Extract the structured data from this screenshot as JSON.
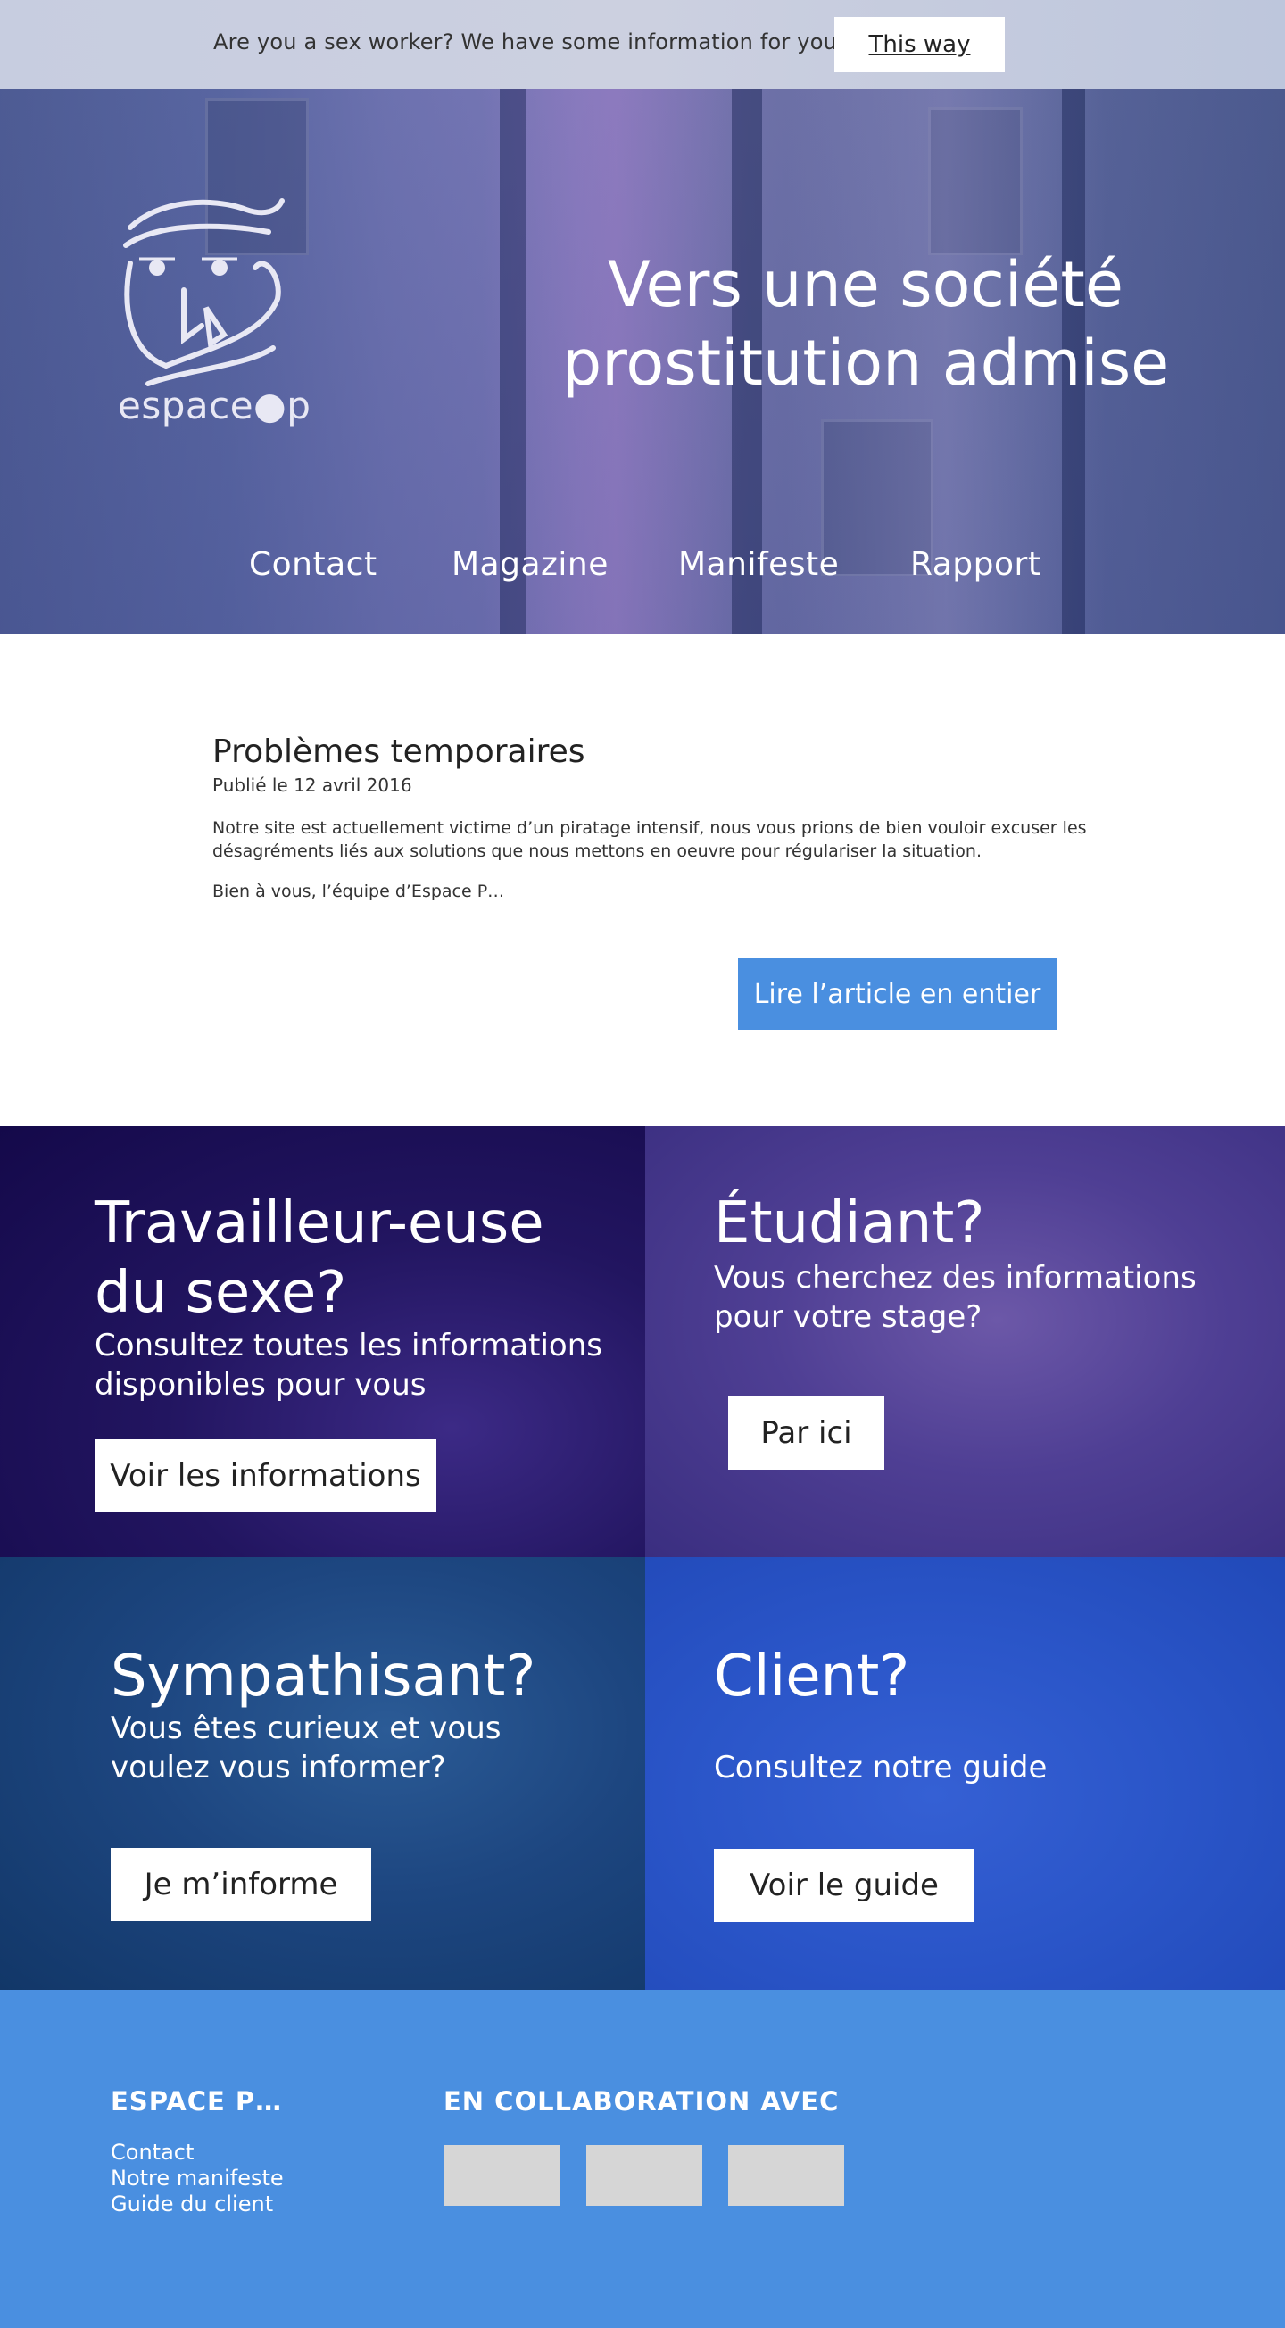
{
  "notice": {
    "text": "Are you a sex worker? We have some information for you",
    "button": "This way"
  },
  "hero": {
    "logo_text": "espace●p",
    "title": "Vers une société prostitution admise"
  },
  "nav": [
    "Contact",
    "Magazine",
    "Manifeste",
    "Rapport"
  ],
  "article": {
    "title": "Problèmes temporaires",
    "date": "Publié le 12 avril 2016",
    "paragraph1": "Notre site est actuellement victime d’un piratage intensif, nous vous prions de bien vouloir excuser les désagréments liés aux solutions que nous mettons en oeuvre pour régulariser la situation.",
    "paragraph2": "Bien à vous, l’équipe d’Espace P…",
    "button": "Lire l’article en entier"
  },
  "tiles": [
    {
      "title": "Travailleur-euse du sexe?",
      "subtitle": "Consultez toutes les informations disponibles pour vous",
      "button": "Voir les informations"
    },
    {
      "title": "Étudiant?",
      "subtitle": "Vous cherchez des informations pour votre stage?",
      "button": "Par ici"
    },
    {
      "title": "Sympathisant?",
      "subtitle": "Vous êtes curieux et vous voulez vous informer?",
      "button": "Je m’informe"
    },
    {
      "title": "Client?",
      "subtitle": "Consultez notre guide",
      "button": "Voir le guide"
    }
  ],
  "footer": {
    "brand_heading": "ESPACE P…",
    "links": [
      "Contact",
      "Notre manifeste",
      "Guide du client"
    ],
    "partners_heading": "EN COLLABORATION AVEC"
  },
  "colors": {
    "accent": "#4a8fe0",
    "tile_sex_worker": "#1b1054",
    "tile_student": "#46388a",
    "tile_sympathizer": "#1a4277",
    "tile_client": "#2a55c8"
  }
}
